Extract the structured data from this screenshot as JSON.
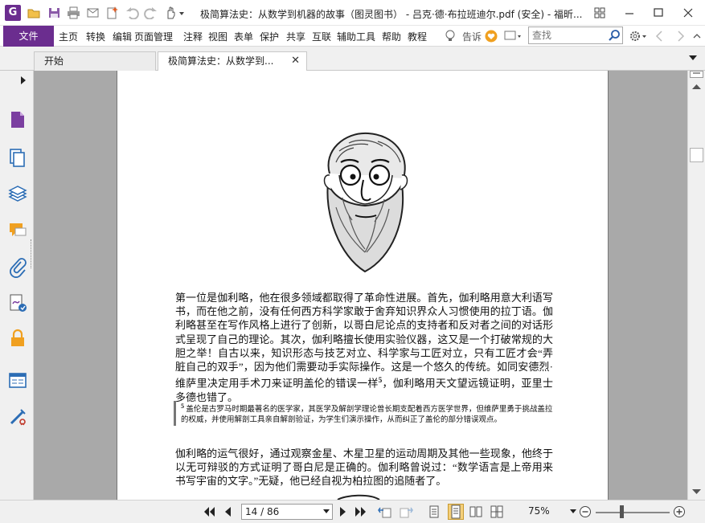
{
  "window": {
    "title": "极简算法史：从数学到机器的故事（图灵图书） - 吕克·德·布拉班迪尔.pdf (安全) - 福昕...",
    "app_logo": "G"
  },
  "menu": {
    "file": "文件",
    "items": [
      "主页",
      "转换",
      "编辑",
      "页面管理",
      "注释",
      "视图",
      "表单",
      "保护",
      "共享",
      "互联",
      "辅助工具",
      "帮助",
      "教程"
    ],
    "tell_me": "告诉",
    "search_placeholder": "查找"
  },
  "tabs": [
    {
      "label": "开始"
    },
    {
      "label": "极简算法史：从数学到..."
    }
  ],
  "document": {
    "para1_a": "第一位是伽利略，他在很多领域都取得了革命性进展。首先，伽利略用意大利语写书，而在他之前，没有任何西方科学家敢于舍弃知识界众人习惯使用的拉丁语。伽利略甚至在写作风格上进行了创新，以哥白尼论点的支持者和反对者之间的对话形式呈现了自己的理论。其次，伽利略擅长使用实验仪器，这又是一个打破常规的大胆之举！自古以来，知识形态与技艺对立、科学家与工匠对立，只有工匠才会“弄脏自己的双手”，因为他们需要动手实际操作。这是一个悠久的传统。如同安德烈·维萨里决定用手术刀来证明盖伦的错误一样",
    "ref": "5",
    "para1_b": "，伽利略用天文望远镜证明，亚里士多德也错了。",
    "footnote_num": "5",
    "footnote": "盖伦是古罗马时期最著名的医学家，其医学及解剖学理论曾长期支配着西方医学世界，但维萨里勇于挑战盖拉的权威，并使用解剖工具亲自解剖验证，为学生们演示操作，从而纠正了盖伦的部分错误观点。",
    "para2": "伽利略的运气很好，通过观察金星、木星卫星的运动周期及其他一些现象，他终于以无可辩驳的方式证明了哥白尼是正确的。伽利略曾说过：“数学语言是上帝用来书写宇宙的文字。”无疑，他已经自视为柏拉图的追随者了。"
  },
  "status": {
    "page_value": "14 / 86",
    "zoom": "75%",
    "zoom_level": 0.35
  },
  "colors": {
    "accent": "#6b2d8f",
    "canvas": "#a9a9a9"
  }
}
